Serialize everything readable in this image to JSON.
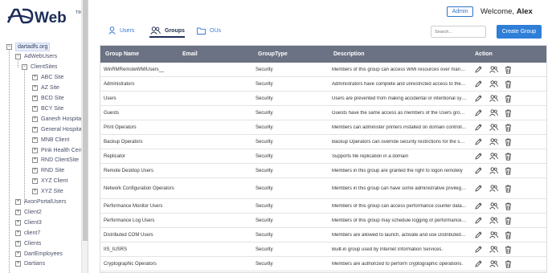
{
  "app": {
    "logo_text": "ADWeb",
    "logo_tm": "TM"
  },
  "header": {
    "role_badge": "Admin",
    "welcome_prefix": "Welcome,",
    "user_name": "Alex"
  },
  "tabs": [
    {
      "label": "Users",
      "icon": "user-icon",
      "active": false
    },
    {
      "label": "Groups",
      "icon": "groups-icon",
      "active": true
    },
    {
      "label": "OUs",
      "icon": "folder-icon",
      "active": false
    }
  ],
  "search": {
    "placeholder": "Search..."
  },
  "toolbar": {
    "create_label": "Create Group"
  },
  "tree": {
    "root": "dartadfs.org",
    "items": [
      {
        "label": "AdWebUsers",
        "toggle": "-"
      },
      {
        "label": "ClientSites",
        "toggle": "-"
      },
      {
        "label": "ABC Site",
        "toggle": "+"
      },
      {
        "label": "AZ Site",
        "toggle": "+"
      },
      {
        "label": "BCD Site",
        "toggle": "+"
      },
      {
        "label": "BCY Site",
        "toggle": "+"
      },
      {
        "label": "Ganesh Hospital",
        "toggle": "+"
      },
      {
        "label": "General Hospital",
        "toggle": "+"
      },
      {
        "label": "MNB Client",
        "toggle": "+"
      },
      {
        "label": "Pink Health Center",
        "toggle": "+"
      },
      {
        "label": "RND ClientSite",
        "toggle": "+"
      },
      {
        "label": "RND Site",
        "toggle": "+"
      },
      {
        "label": "XYZ Client",
        "toggle": "+"
      },
      {
        "label": "XYZ Site",
        "toggle": "+"
      },
      {
        "label": "AxonPortalUsers",
        "toggle": "+"
      },
      {
        "label": "Client2",
        "toggle": "+"
      },
      {
        "label": "Client3",
        "toggle": "+"
      },
      {
        "label": "client7",
        "toggle": "+"
      },
      {
        "label": "Clients",
        "toggle": "+"
      },
      {
        "label": "DartEmployees",
        "toggle": "+"
      },
      {
        "label": "Dartians",
        "toggle": "+"
      }
    ]
  },
  "table": {
    "columns": [
      "Group Name",
      "Email",
      "GroupType",
      "Description",
      "Action"
    ],
    "rows": [
      {
        "name": "WinRMRemoteWMIUsers__",
        "email": "",
        "type": "Security",
        "desc": "Members of this group can access WMI resources over management protocols"
      },
      {
        "name": "Administrators",
        "email": "",
        "type": "Security",
        "desc": "Administrators have complete and unrestricted access to the computer/domain"
      },
      {
        "name": "Users",
        "email": "",
        "type": "Security",
        "desc": "Users are prevented from making accidental or intentional system-wide changes"
      },
      {
        "name": "Guests",
        "email": "",
        "type": "Security",
        "desc": "Guests have the same access as members of the Users group by default"
      },
      {
        "name": "Print Operators",
        "email": "",
        "type": "Security",
        "desc": "Members can administer printers installed on domain controllers"
      },
      {
        "name": "Backup Operators",
        "email": "",
        "type": "Security",
        "desc": "Backup Operators can override security restrictions for the sole purpose of backing up"
      },
      {
        "name": "Replicator",
        "email": "",
        "type": "Security",
        "desc": "Supports file replication in a domain"
      },
      {
        "name": "Remote Desktop Users",
        "email": "",
        "type": "Security",
        "desc": "Members in this group are granted the right to logon remotely"
      },
      {
        "name": "Network Configuration Operators",
        "email": "",
        "type": "Security",
        "desc": "Members in this group can have some administrative privileges to manage configuration"
      },
      {
        "name": "Performance Monitor Users",
        "email": "",
        "type": "Security",
        "desc": "Members of this group can access performance counter data locally and remotely"
      },
      {
        "name": "Performance Log Users",
        "email": "",
        "type": "Security",
        "desc": "Members of this group may schedule logging of performance counters"
      },
      {
        "name": "Distributed COM Users",
        "email": "",
        "type": "Security",
        "desc": "Members are allowed to launch, activate and use Distributed COM objects on this machine"
      },
      {
        "name": "IIS_IUSRS",
        "email": "",
        "type": "Security",
        "desc": "Built-in group used by Internet Information Services."
      },
      {
        "name": "Cryptographic Operators",
        "email": "",
        "type": "Security",
        "desc": "Members are authorized to perform cryptographic operations."
      }
    ],
    "action_icons": [
      "edit-icon",
      "manage-members-icon",
      "delete-icon"
    ]
  },
  "colors": {
    "primary": "#2f7ed8",
    "header_bg": "#6b7283",
    "tab_active": "#1f2e57",
    "link": "#3a78d4"
  }
}
